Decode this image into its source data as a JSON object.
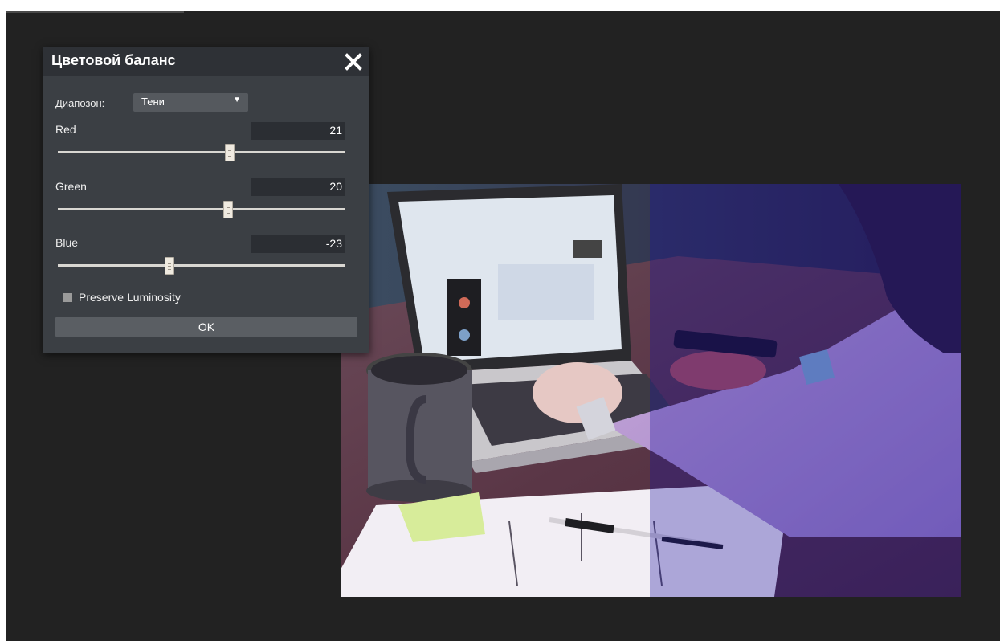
{
  "dialog": {
    "title": "Цветовой баланс",
    "close_icon": "close-icon",
    "range_label": "Диапозон:",
    "range_value": "Тени",
    "range_arrow": "▼",
    "sliders": [
      {
        "name": "Red",
        "value": "21",
        "min": -100,
        "max": 100
      },
      {
        "name": "Green",
        "value": "20",
        "min": -100,
        "max": 100
      },
      {
        "name": "Blue",
        "value": "-23",
        "min": -100,
        "max": 100
      }
    ],
    "preserve_luminosity_label": "Preserve Luminosity",
    "preserve_luminosity_checked": false,
    "ok_label": "OK"
  },
  "canvas": {
    "image_subject": "photo-laptop-desk",
    "preview_split": true
  },
  "colors": {
    "workspace": "#222222",
    "dialog_bg": "#3b3f44",
    "titlebar_bg": "#2e3136",
    "field_bg": "#2b2e33",
    "button_bg": "#5a5e63"
  }
}
